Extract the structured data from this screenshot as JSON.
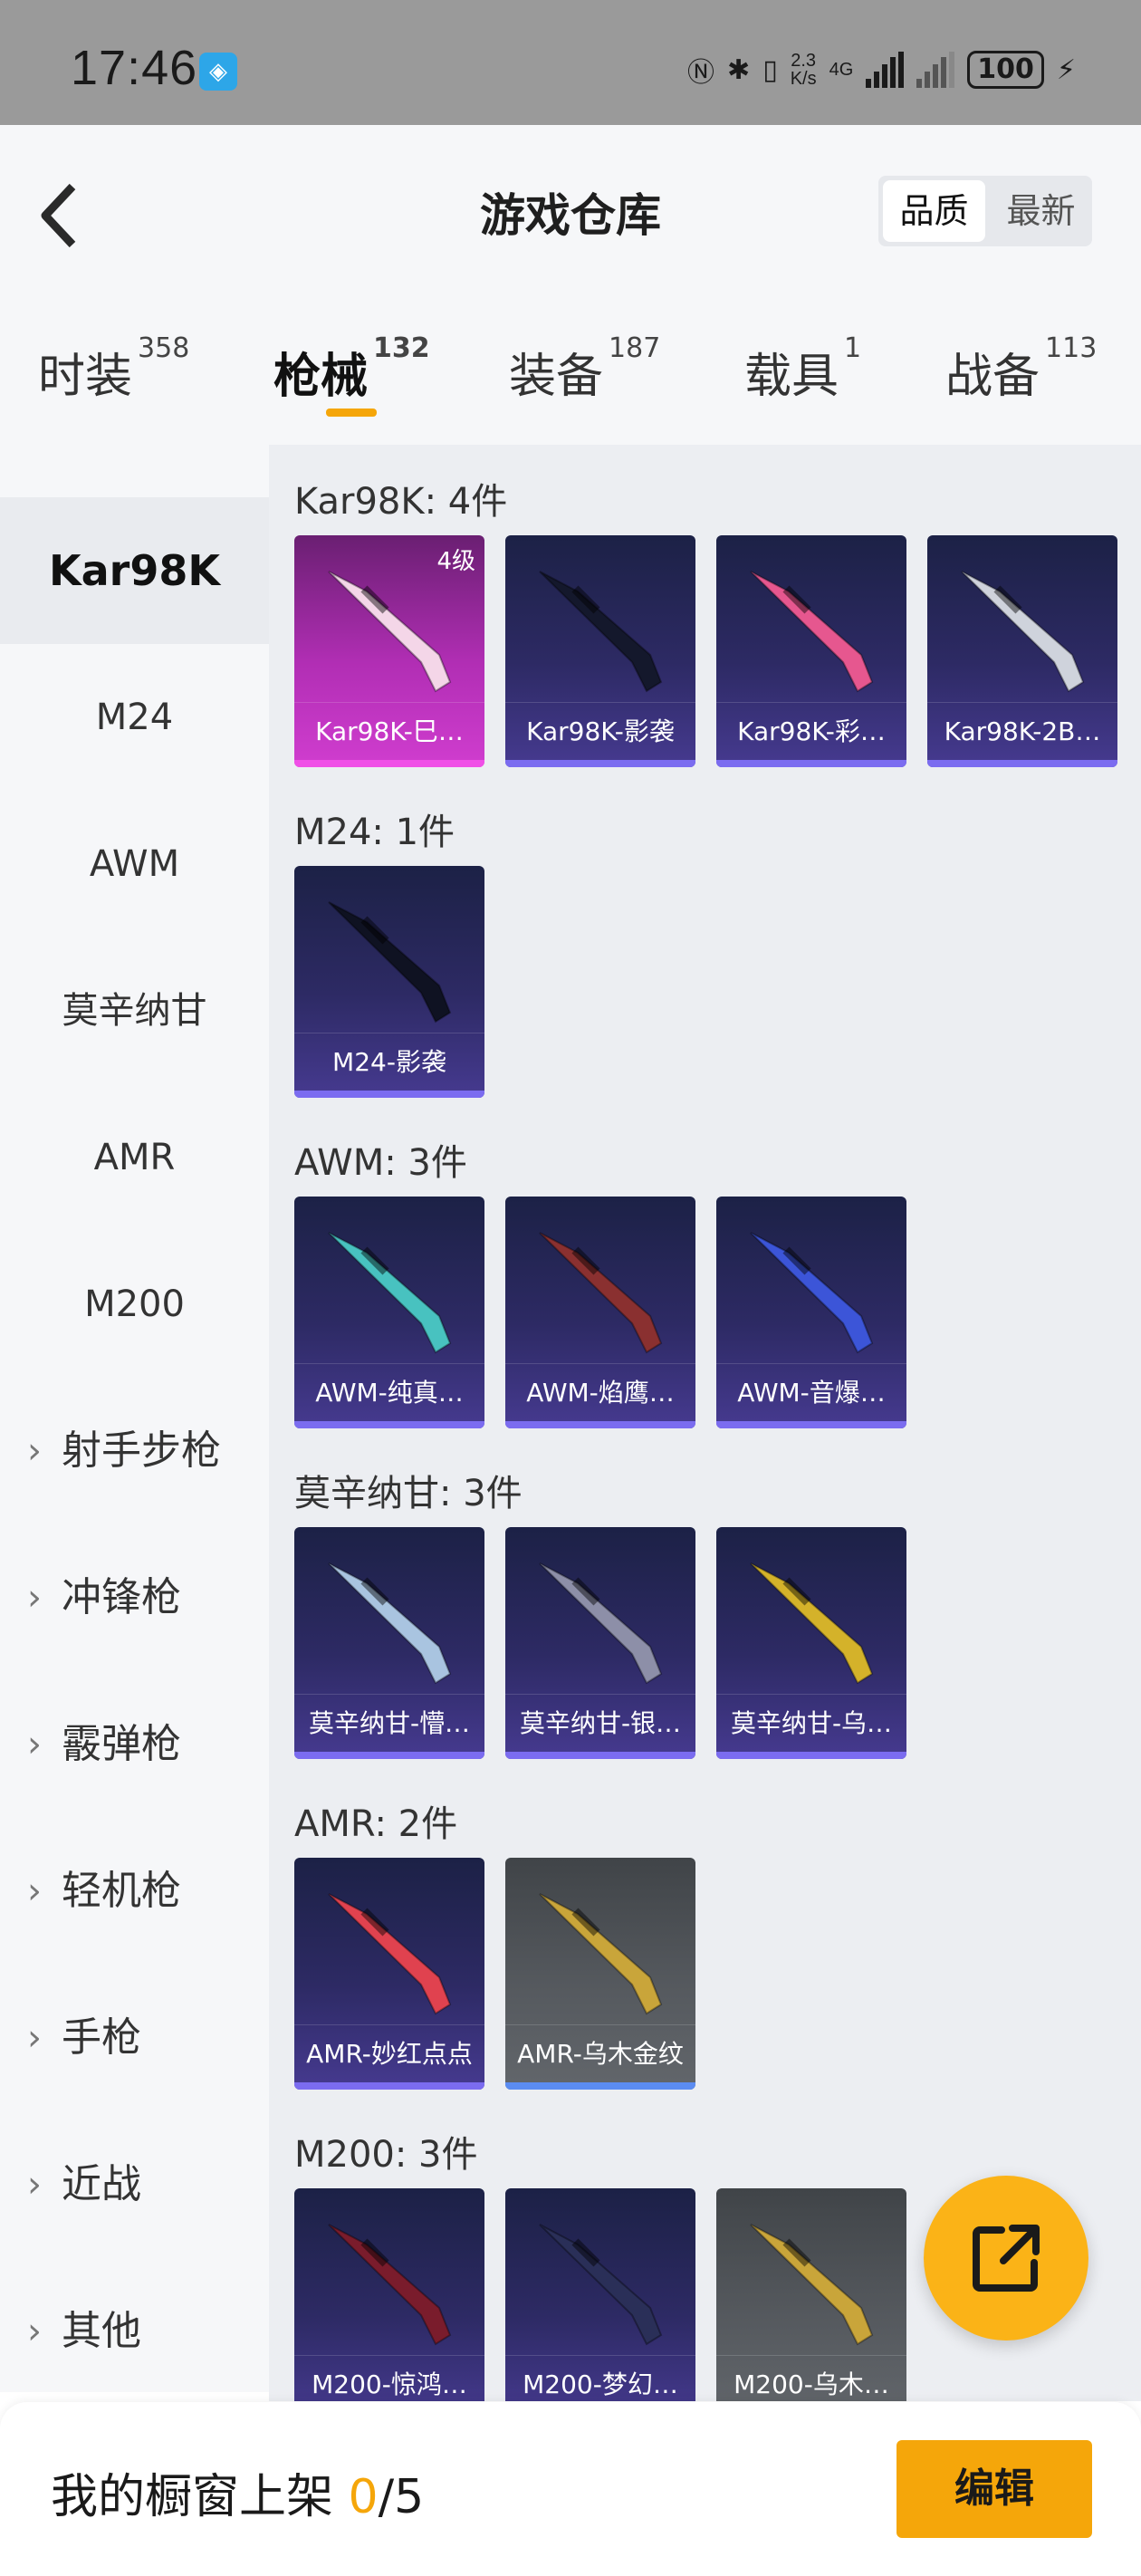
{
  "status_bar": {
    "time": "17:46",
    "net_speed_value": "2.3",
    "net_speed_unit": "K/s",
    "network_type": "4G",
    "battery": "100"
  },
  "header": {
    "title": "游戏仓库",
    "sort_quality": "品质",
    "sort_latest": "最新"
  },
  "tabs": [
    {
      "label": "时装",
      "count": "358"
    },
    {
      "label": "枪械",
      "count": "132"
    },
    {
      "label": "装备",
      "count": "187"
    },
    {
      "label": "载具",
      "count": "1"
    },
    {
      "label": "战备",
      "count": "113"
    }
  ],
  "sidebar": {
    "items": [
      "Kar98K",
      "M24",
      "AWM",
      "莫辛纳甘",
      "AMR",
      "M200"
    ],
    "groups": [
      "射手步枪",
      "冲锋枪",
      "霰弹枪",
      "轻机枪",
      "手枪",
      "近战",
      "其他"
    ]
  },
  "sections": [
    {
      "title": "Kar98K: 4件",
      "items": [
        {
          "label": "Kar98K-巳…",
          "level": "4级",
          "style": "pink",
          "gun_color": "#f4d6e8"
        },
        {
          "label": "Kar98K-影袭",
          "style": "purple",
          "gun_color": "#14182c"
        },
        {
          "label": "Kar98K-彩…",
          "style": "purple",
          "gun_color": "#e6578f"
        },
        {
          "label": "Kar98K-2B…",
          "style": "purple",
          "gun_color": "#cfd3dc"
        }
      ]
    },
    {
      "title": "M24: 1件",
      "items": [
        {
          "label": "M24-影袭",
          "style": "purple",
          "gun_color": "#0f1222"
        }
      ]
    },
    {
      "title": "AWM: 3件",
      "items": [
        {
          "label": "AWM-纯真…",
          "style": "purple",
          "gun_color": "#48c2c0"
        },
        {
          "label": "AWM-焰鹰…",
          "style": "purple",
          "gun_color": "#8a3030"
        },
        {
          "label": "AWM-音爆…",
          "style": "purple",
          "gun_color": "#3c55d8"
        }
      ]
    },
    {
      "title": "莫辛纳甘: 3件",
      "items": [
        {
          "label": "莫辛纳甘-懵…",
          "style": "purple",
          "gun_color": "#a9c4e0"
        },
        {
          "label": "莫辛纳甘-银…",
          "style": "purple",
          "gun_color": "#8d8fa8"
        },
        {
          "label": "莫辛纳甘-乌…",
          "style": "purple",
          "gun_color": "#d4b22a"
        }
      ]
    },
    {
      "title": "AMR: 2件",
      "items": [
        {
          "label": "AMR-妙红点点",
          "style": "purple",
          "gun_color": "#e0424f"
        },
        {
          "label": "AMR-乌木金纹",
          "style": "grey",
          "gun_color": "#c9a53a"
        }
      ]
    },
    {
      "title": "M200: 3件",
      "items": [
        {
          "label": "M200-惊鸿…",
          "style": "purple",
          "gun_color": "#7a1c2c"
        },
        {
          "label": "M200-梦幻…",
          "style": "purple",
          "gun_color": "#2a2f58"
        },
        {
          "label": "M200-乌木…",
          "style": "grey",
          "gun_color": "#c9a53a"
        }
      ]
    }
  ],
  "footer": {
    "shelf_label": "我的橱窗上架",
    "shelf_current": "0",
    "shelf_total": "/5",
    "edit_label": "编辑"
  },
  "colors": {
    "accent": "#f5a60a",
    "fab": "#fbb317",
    "card_purple": "#2d2a64",
    "card_pink": "#b12eb4",
    "card_grey": "#55595e"
  },
  "icons": {
    "back": "chevron-left-icon",
    "fab": "share-external-icon",
    "group_chevron": "chevron-right-icon"
  }
}
